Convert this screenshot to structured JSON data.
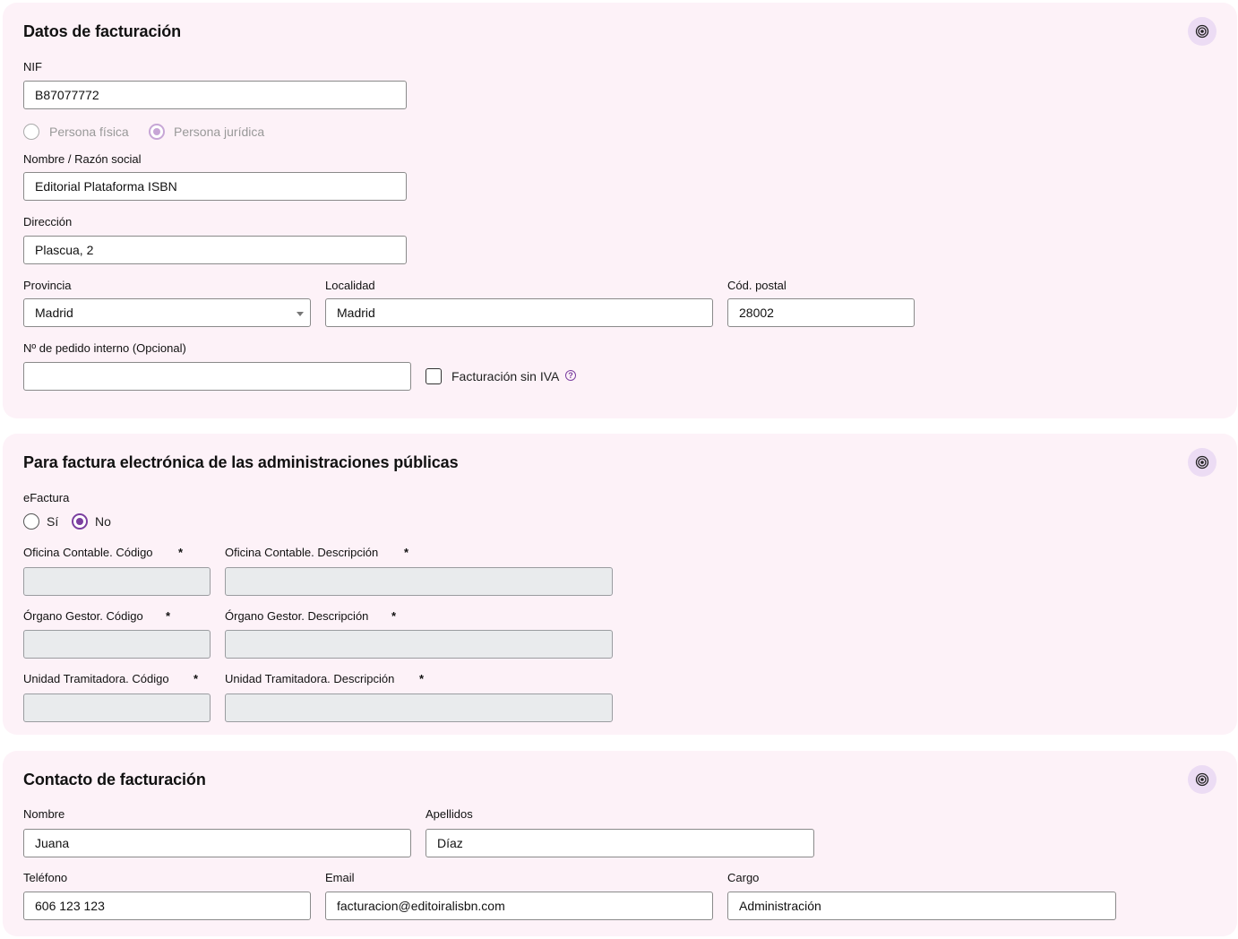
{
  "datos": {
    "title": "Datos de facturación",
    "nif": {
      "label": "NIF",
      "value": "B87077772"
    },
    "persona": {
      "fisica": "Persona física",
      "juridica": "Persona jurídica",
      "selected": "juridica"
    },
    "nombre": {
      "label": "Nombre / Razón social",
      "value": "Editorial Plataforma ISBN"
    },
    "direccion": {
      "label": "Dirección",
      "value": "Plascua, 2"
    },
    "provincia": {
      "label": "Provincia",
      "value": "Madrid"
    },
    "localidad": {
      "label": "Localidad",
      "value": "Madrid"
    },
    "cp": {
      "label": "Cód. postal",
      "value": "28002"
    },
    "pedido": {
      "label": "Nº de pedido interno (Opcional)",
      "value": ""
    },
    "sin_iva": {
      "label": "Facturación sin IVA",
      "checked": false,
      "help": "?"
    }
  },
  "efactura": {
    "title": "Para factura electrónica de las administraciones públicas",
    "label": "eFactura",
    "si": "Sí",
    "no": "No",
    "selected": "no",
    "required_mark": "*",
    "oficina_codigo": {
      "label": "Oficina Contable. Código",
      "value": ""
    },
    "oficina_desc": {
      "label": "Oficina Contable. Descripción",
      "value": ""
    },
    "organo_codigo": {
      "label": "Órgano Gestor. Código",
      "value": ""
    },
    "organo_desc": {
      "label": "Órgano Gestor. Descripción",
      "value": ""
    },
    "unidad_codigo": {
      "label": "Unidad Tramitadora. Código",
      "value": ""
    },
    "unidad_desc": {
      "label": "Unidad Tramitadora. Descripción",
      "value": ""
    }
  },
  "contacto": {
    "title": "Contacto de facturación",
    "nombre": {
      "label": "Nombre",
      "value": "Juana"
    },
    "apellidos": {
      "label": "Apellidos",
      "value": "Díaz"
    },
    "telefono": {
      "label": "Teléfono",
      "value": "606 123 123"
    },
    "email": {
      "label": "Email",
      "value": "facturacion@editoiralisbn.com"
    },
    "cargo": {
      "label": "Cargo",
      "value": "Administración"
    }
  },
  "icons": {
    "section_settings": "target-icon"
  },
  "colors": {
    "card_bg": "#fdf2f8",
    "accent": "#7b3fa0",
    "disabled_bg": "#e9ebed"
  }
}
